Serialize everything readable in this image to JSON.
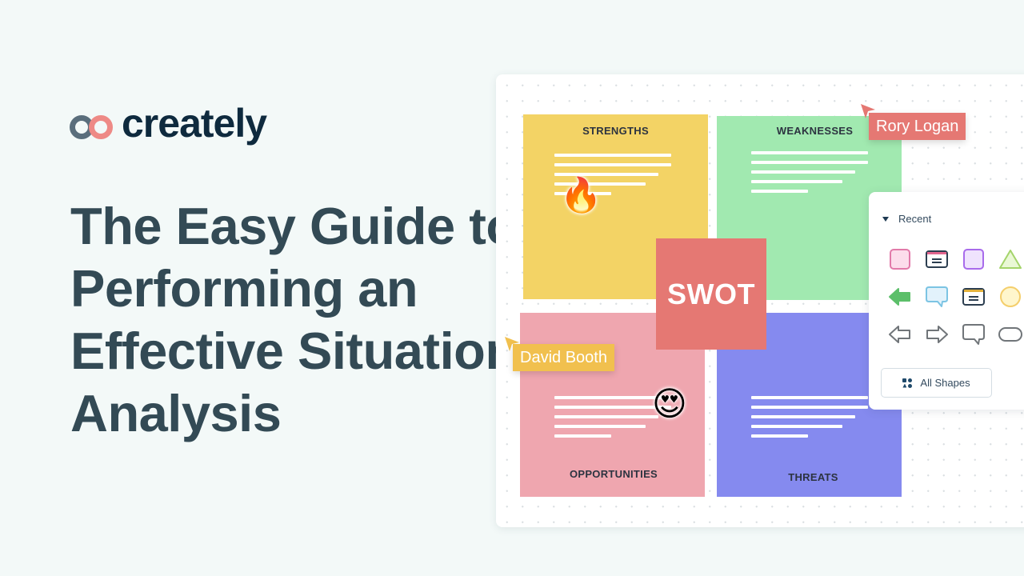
{
  "brand": {
    "name": "creately",
    "colors": {
      "ring_left": "#5A6E7C",
      "ring_right": "#EE8A86",
      "text": "#0E2A3E"
    }
  },
  "headline": {
    "lines": [
      "The Easy Guide to",
      "Performing an",
      "Effective Situation",
      "Analysis"
    ]
  },
  "swot": {
    "center_label": "SWOT",
    "quadrants": [
      {
        "id": "strengths",
        "title": "STRENGTHS",
        "color": "#F3D365",
        "emoji": "🔥"
      },
      {
        "id": "weaknesses",
        "title": "WEAKNESSES",
        "color": "#A1E9B0"
      },
      {
        "id": "opportunities",
        "title": "OPPORTUNITIES",
        "color": "#EFA6AF",
        "emoji": "😍"
      },
      {
        "id": "threats",
        "title": "THREATS",
        "color": "#858AEF"
      }
    ]
  },
  "collaborators": [
    {
      "name": "Rory Logan",
      "color": "#E57873"
    },
    {
      "name": "David Booth",
      "color": "#F1C04E"
    }
  ],
  "shapes_panel": {
    "section_label": "Recent",
    "shapes": [
      "pink-rectangle",
      "pink-window-card",
      "purple-rectangle",
      "green-triangle",
      "green-left-arrow",
      "blue-speech-bubble",
      "yellow-window-card",
      "yellow-circle",
      "outline-left-arrow",
      "outline-right-arrow",
      "outline-speech-bubble",
      "outline-rounded-rectangle"
    ],
    "all_shapes_label": "All Shapes"
  }
}
